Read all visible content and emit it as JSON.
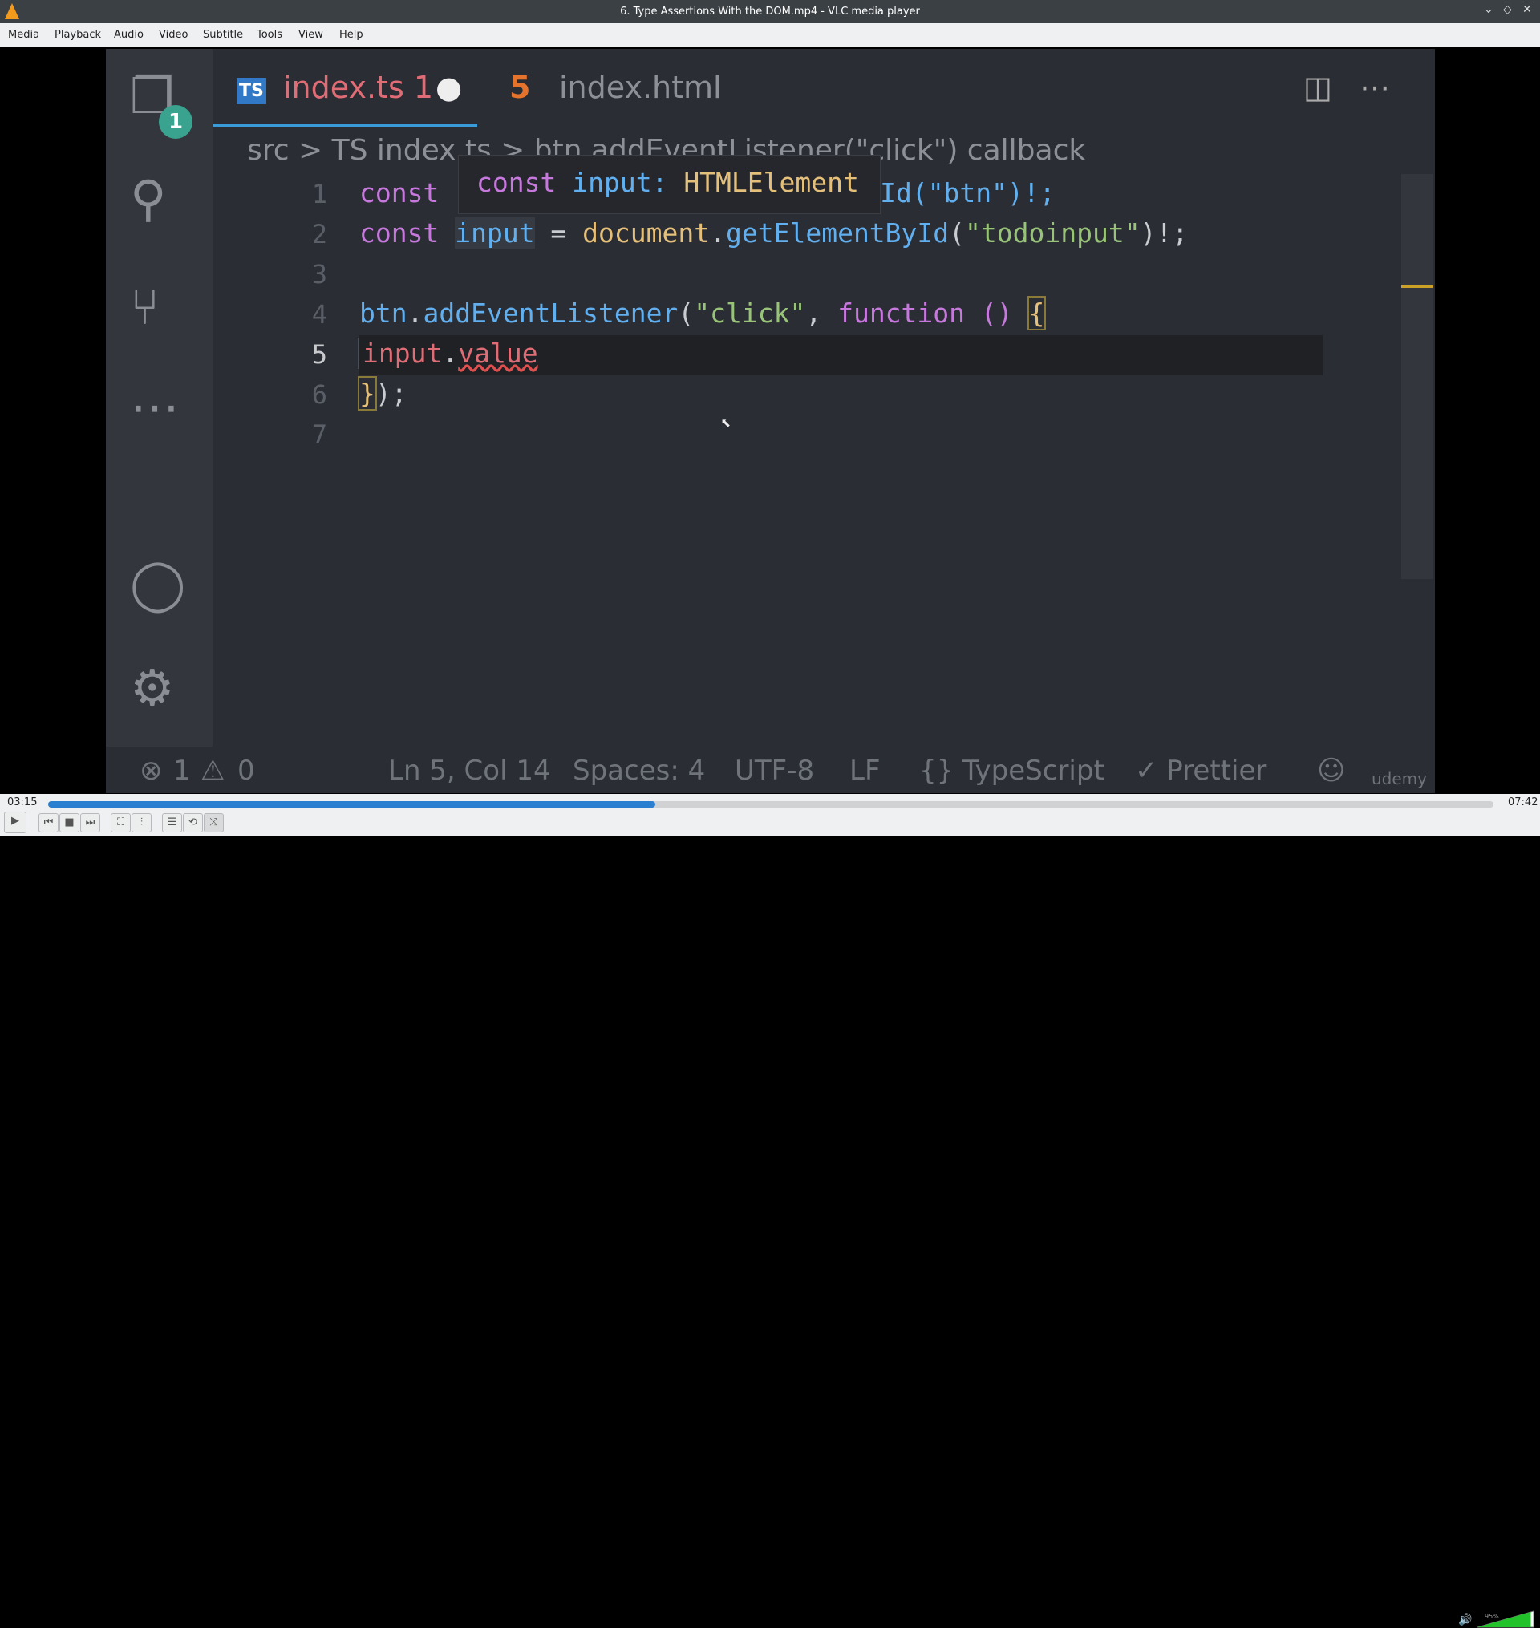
{
  "window": {
    "title": "6. Type Assertions With the DOM.mp4 - VLC media player"
  },
  "menu": [
    "Media",
    "Playback",
    "Audio",
    "Video",
    "Subtitle",
    "Tools",
    "View",
    "Help"
  ],
  "video_frame": {
    "explorer_badge": "1",
    "tabs": [
      {
        "label": "index.ts 1",
        "icon": "TS",
        "modified": true
      },
      {
        "label": "index.html",
        "icon": "5"
      }
    ],
    "breadcrumb": "src > TS index.ts > btn.addEventListener(\"click\") callback",
    "hover": {
      "keyword": "const",
      "name": "input:",
      "type": "HTMLElement"
    },
    "line_numbers": [
      "1",
      "2",
      "3",
      "4",
      "5",
      "6",
      "7"
    ],
    "lines": {
      "l1a": "const ",
      "l1b": "yId(\"btn\")!;",
      "l2a": "const ",
      "l2b": "input",
      "l2c": " = ",
      "l2d": "document",
      "l2e": ".",
      "l2f": "getElementById",
      "l2g": "(",
      "l2h": "\"todoinput\"",
      "l2i": ")!;",
      "l4a": "btn",
      "l4b": ".",
      "l4c": "addEventListener",
      "l4d": "(",
      "l4e": "\"click\"",
      "l4f": ", ",
      "l4g": "function",
      "l4h": " () ",
      "l4i": "{",
      "l5a": "input",
      "l5b": ".",
      "l5c": "value",
      "l6a": "}",
      "l6b": ");"
    },
    "status": {
      "errors": "1",
      "warnings": "0",
      "position": "Ln 5, Col 14",
      "spaces": "Spaces: 4",
      "encoding": "UTF-8",
      "eol": "LF",
      "language": "{} TypeScript",
      "formatter": "✓ Prettier",
      "watermark": "udemy"
    }
  },
  "player": {
    "elapsed": "03:15",
    "total": "07:42",
    "progress": 0.42,
    "volume": "95%",
    "volume_level": 0.95,
    "accent": "#2b7fd1"
  }
}
